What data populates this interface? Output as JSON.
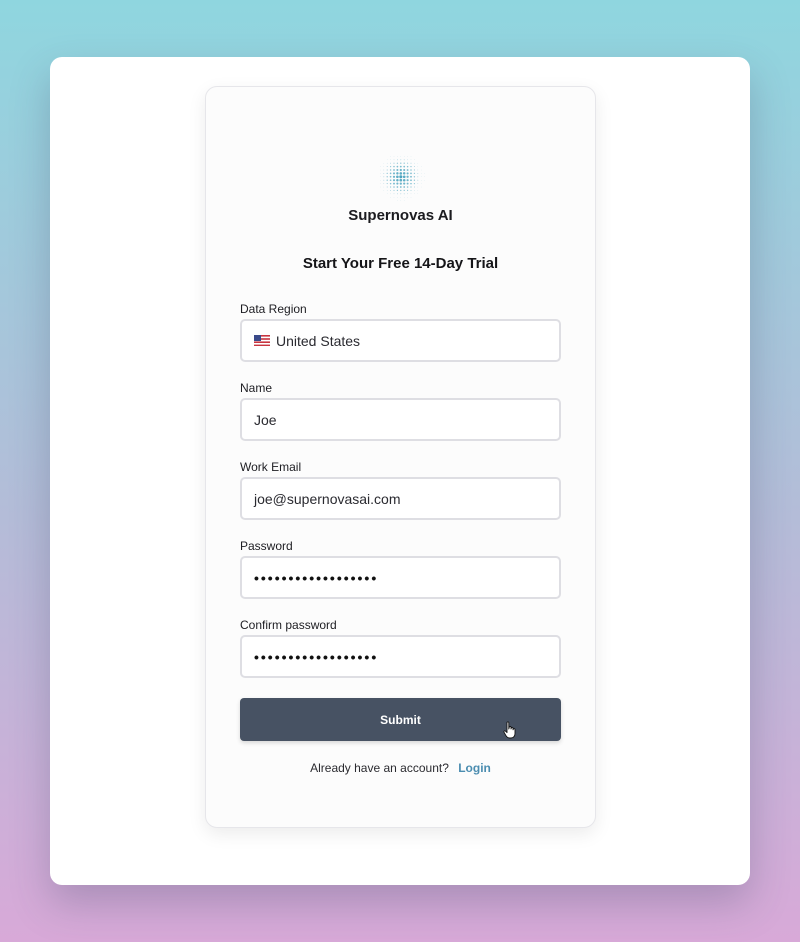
{
  "brand": {
    "name": "Supernovas AI",
    "logo_icon": "supernova-dot-logo-icon",
    "logo_color": "#4aa3be"
  },
  "form": {
    "title": "Start Your Free 14-Day Trial",
    "data_region": {
      "label": "Data Region",
      "value": "United States",
      "flag_icon": "us-flag-icon"
    },
    "name": {
      "label": "Name",
      "value": "Joe"
    },
    "work_email": {
      "label": "Work Email",
      "value": "joe@supernovasai.com"
    },
    "password": {
      "label": "Password",
      "value": "••••••••••••••••••"
    },
    "confirm_password": {
      "label": "Confirm password",
      "value": "••••••••••••••••••"
    },
    "submit_label": "Submit"
  },
  "footer": {
    "prompt": "Already have an account?",
    "login_label": "Login"
  },
  "colors": {
    "submit_bg": "#475263",
    "link": "#4b8db0",
    "card_bg": "#fcfcfc"
  }
}
